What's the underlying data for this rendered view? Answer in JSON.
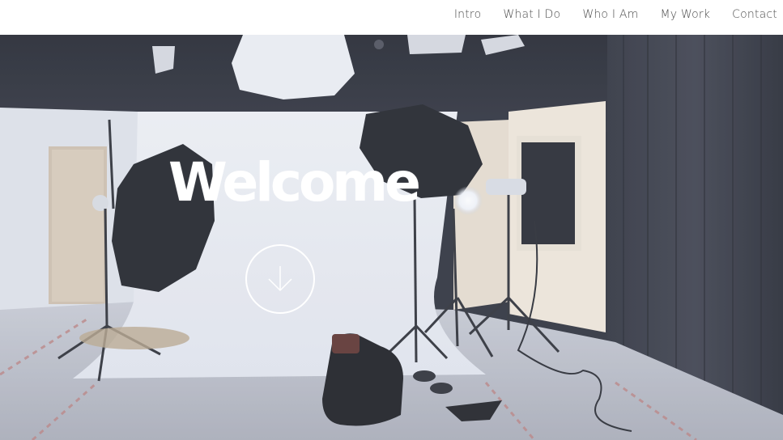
{
  "nav": {
    "items": [
      {
        "label": "Intro"
      },
      {
        "label": "What I Do"
      },
      {
        "label": "Who I Am"
      },
      {
        "label": "My Work"
      },
      {
        "label": "Contact"
      }
    ]
  },
  "hero": {
    "title": "Welcome",
    "scroll_icon": "arrow-down-icon",
    "background_image": "photo-studio-icon"
  },
  "colors": {
    "nav_background": "#ffffff",
    "nav_text": "#4b4b4b",
    "hero_text": "#ffffff"
  }
}
